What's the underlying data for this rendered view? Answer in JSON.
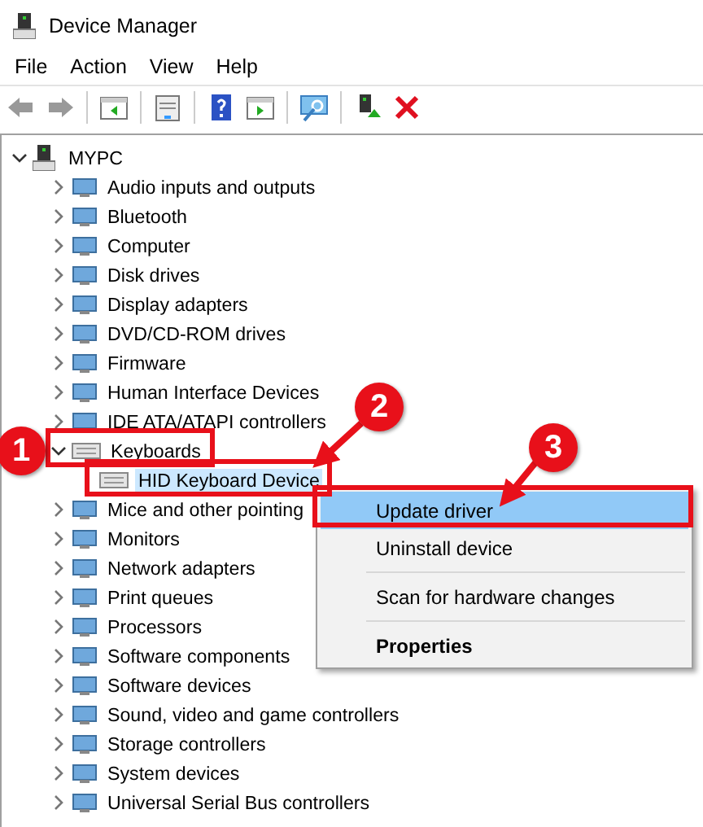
{
  "window": {
    "title": "Device Manager"
  },
  "menu": [
    "File",
    "Action",
    "View",
    "Help"
  ],
  "tree": {
    "label": "MYPC",
    "expanded": true,
    "children": [
      {
        "label": "Audio inputs and outputs",
        "expanded": false
      },
      {
        "label": "Bluetooth",
        "expanded": false
      },
      {
        "label": "Computer",
        "expanded": false
      },
      {
        "label": "Disk drives",
        "expanded": false
      },
      {
        "label": "Display adapters",
        "expanded": false
      },
      {
        "label": "DVD/CD-ROM drives",
        "expanded": false
      },
      {
        "label": "Firmware",
        "expanded": false
      },
      {
        "label": "Human Interface Devices",
        "expanded": false
      },
      {
        "label": "IDE ATA/ATAPI controllers",
        "expanded": false
      },
      {
        "label": "Keyboards",
        "expanded": true,
        "children": [
          {
            "label": "HID Keyboard Device",
            "selected": true
          }
        ]
      },
      {
        "label": "Mice and other pointing",
        "expanded": false
      },
      {
        "label": "Monitors",
        "expanded": false
      },
      {
        "label": "Network adapters",
        "expanded": false
      },
      {
        "label": "Print queues",
        "expanded": false
      },
      {
        "label": "Processors",
        "expanded": false
      },
      {
        "label": "Software components",
        "expanded": false
      },
      {
        "label": "Software devices",
        "expanded": false
      },
      {
        "label": "Sound, video and game controllers",
        "expanded": false
      },
      {
        "label": "Storage controllers",
        "expanded": false
      },
      {
        "label": "System devices",
        "expanded": false
      },
      {
        "label": "Universal Serial Bus controllers",
        "expanded": false
      }
    ]
  },
  "context_menu": {
    "items": [
      {
        "kind": "item",
        "label": "Update driver",
        "selected": true
      },
      {
        "kind": "item",
        "label": "Uninstall device",
        "selected": false
      },
      {
        "kind": "separator"
      },
      {
        "kind": "item",
        "label": "Scan for hardware changes",
        "selected": false
      },
      {
        "kind": "separator"
      },
      {
        "kind": "default",
        "label": "Properties",
        "selected": false
      }
    ]
  },
  "callouts": [
    "1",
    "2",
    "3"
  ]
}
